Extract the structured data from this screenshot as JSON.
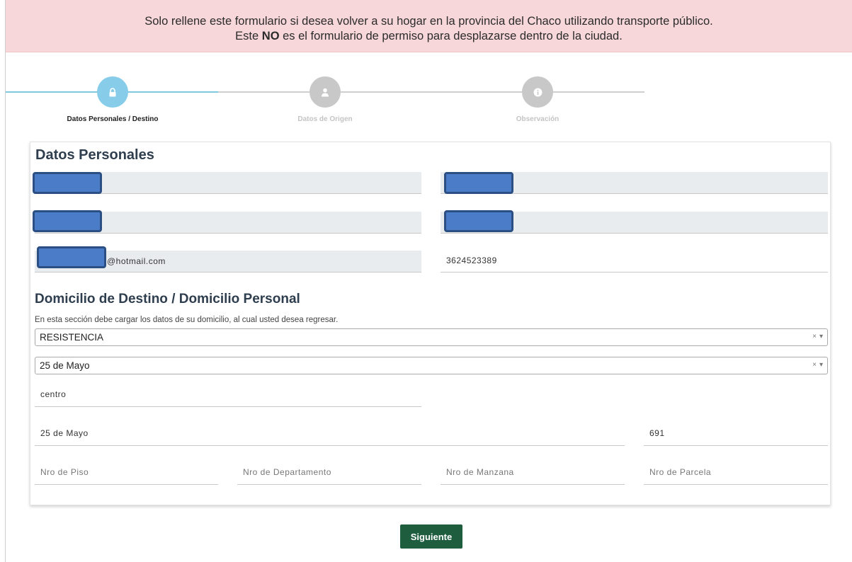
{
  "alert": {
    "line1": "Solo rellene este formulario si desea volver a su hogar en la provincia del Chaco utilizando transporte público.",
    "line2_pre": "Este ",
    "line2_bold": "NO",
    "line2_post": " es el formulario de permiso para desplazarse dentro de la ciudad."
  },
  "stepper": {
    "steps": [
      {
        "label": "Datos Personales / Destino",
        "icon": "lock-icon",
        "active": true
      },
      {
        "label": "Datos de Origen",
        "icon": "user-icon",
        "active": false
      },
      {
        "label": "Observación",
        "icon": "info-icon",
        "active": false
      }
    ]
  },
  "personal": {
    "title": "Datos Personales",
    "email_suffix": "@hotmail.com",
    "phone": "3624523389"
  },
  "destino": {
    "title": "Domicilio de Destino / Domicilio Personal",
    "hint": "En esta sección debe cargar los datos de su domicilio, al cual usted desea regresar.",
    "localidad": "RESISTENCIA",
    "calle_select": "25 de Mayo",
    "barrio": "centro",
    "calle": "25 de Mayo",
    "numero": "691",
    "piso_placeholder": "Nro de Piso",
    "depto_placeholder": "Nro de Departamento",
    "manzana_placeholder": "Nro de Manzana",
    "parcela_placeholder": "Nro de Parcela",
    "clear_symbol": "×",
    "arrow_symbol": "▾"
  },
  "actions": {
    "next_label": "Siguiente"
  },
  "colors": {
    "alert_bg": "#f8d7da",
    "step_active": "#87cdea",
    "step_inactive": "#c8c8c8",
    "line_active": "#7fc9df",
    "button_bg": "#1e5e3f",
    "redaction": "#4a7cc7"
  }
}
